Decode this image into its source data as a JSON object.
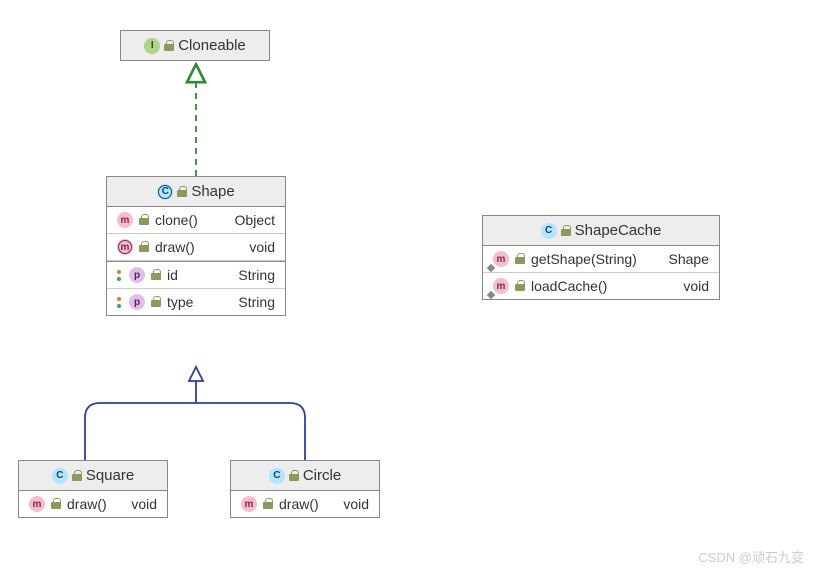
{
  "interfaces": {
    "cloneable": {
      "name": "Cloneable"
    }
  },
  "classes": {
    "shape": {
      "name": "Shape",
      "methods": [
        {
          "name": "clone()",
          "type": "Object",
          "abstract": false
        },
        {
          "name": "draw()",
          "type": "void",
          "abstract": true
        }
      ],
      "properties": [
        {
          "name": "id",
          "type": "String"
        },
        {
          "name": "type",
          "type": "String"
        }
      ]
    },
    "square": {
      "name": "Square",
      "methods": [
        {
          "name": "draw()",
          "type": "void"
        }
      ]
    },
    "circle": {
      "name": "Circle",
      "methods": [
        {
          "name": "draw()",
          "type": "void"
        }
      ]
    },
    "shapecache": {
      "name": "ShapeCache",
      "methods": [
        {
          "name": "getShape(String)",
          "type": "Shape"
        },
        {
          "name": "loadCache()",
          "type": "void"
        }
      ]
    }
  },
  "badges": {
    "i": "I",
    "c": "C",
    "m": "m",
    "p": "p"
  },
  "watermark": "CSDN @顽石九变"
}
